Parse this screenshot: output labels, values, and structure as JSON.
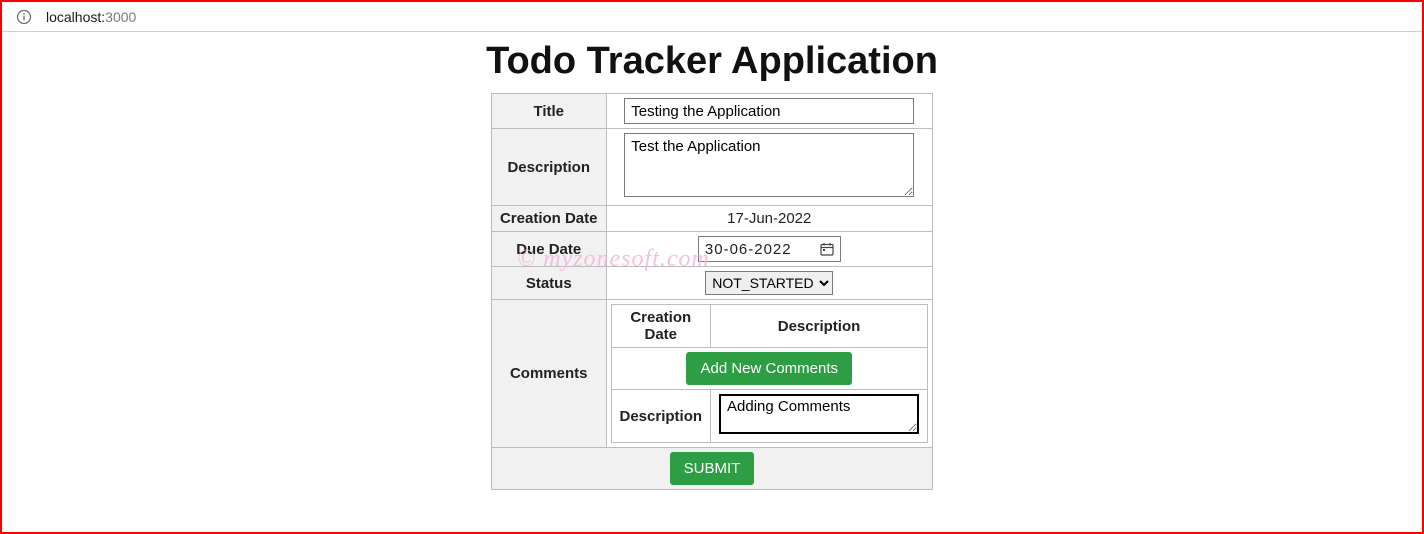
{
  "browser": {
    "url_host": "localhost:",
    "url_port": "3000"
  },
  "watermark": "© myzonesoft.com",
  "header": {
    "title": "Todo Tracker Application"
  },
  "form": {
    "labels": {
      "title": "Title",
      "description": "Description",
      "creation_date": "Creation Date",
      "due_date": "Due Date",
      "status": "Status",
      "comments": "Comments"
    },
    "values": {
      "title": "Testing the Application",
      "description": "Test the Application",
      "creation_date": "17-Jun-2022",
      "due_date": "30-06-2022",
      "status_selected": "NOT_STARTED"
    },
    "status_options": [
      "NOT_STARTED"
    ],
    "comments": {
      "headers": {
        "creation_date": "Creation Date",
        "description": "Description"
      },
      "add_button": "Add New Comments",
      "desc_label": "Description",
      "desc_value": "Adding Comments"
    },
    "submit_label": "SUBMIT"
  }
}
